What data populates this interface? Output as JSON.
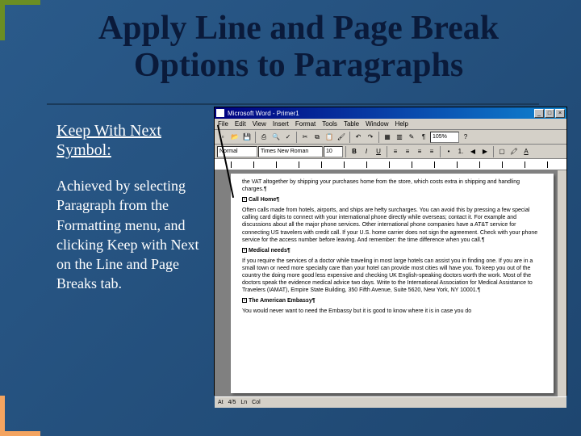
{
  "title": "Apply Line and Page Break Options to Paragraphs",
  "subheading": "Keep With Next Symbol:",
  "bodytext": "Achieved by selecting Paragraph from the Formatting menu, and clicking Keep with Next on the Line and Page Breaks tab.",
  "word": {
    "titlebar": "Microsoft Word - Primer1",
    "menu": [
      "File",
      "Edit",
      "View",
      "Insert",
      "Format",
      "Tools",
      "Table",
      "Window",
      "Help"
    ],
    "style_drop": "Normal",
    "font_drop": "Times New Roman",
    "size_drop": "10",
    "zoom_drop": "105%",
    "doc": {
      "p1": "the VAT altogether by shipping your purchases home from the store, which costs extra in shipping and handling charges.¶",
      "h1": "Call Home¶",
      "p2": "Often calls made from hotels, airports, and ships are hefty surcharges. You can avoid this by pressing a few special calling card digits to connect with your international phone directly while overseas; contact it. For example and discussions about all the major phone services. Other international phone companies have a AT&T service for connecting US travelers with credit call. If your U.S. home carrier does not sign the agreement. Check with your phone service for the access number before leaving. And remember: the time difference when you call.¶",
      "h2": "Medical needs¶",
      "p3": "If you require the services of a doctor while traveling in most large hotels can assist you in finding one. If you are in a small town or need more specialty care than your hotel can provide most cities will have you. To keep you out of the country the doing more good less expensive and checking UK English-speaking doctors worth the work. Most of the doctors speak the evidence medical advice two days. Write to the International Association for Medical Assistance to Travelers (IAMAT), Empire State Building, 350 Fifth Avenue, Suite 5620, New York, NY 10001.¶",
      "h3": "The American Embassy¶",
      "p4": "You would never want to need the Embassy but it is good to know where it is in case you do"
    },
    "status": {
      "page": "At",
      "sec": "4/5",
      "ln": "Ln",
      "col": "Col"
    }
  }
}
